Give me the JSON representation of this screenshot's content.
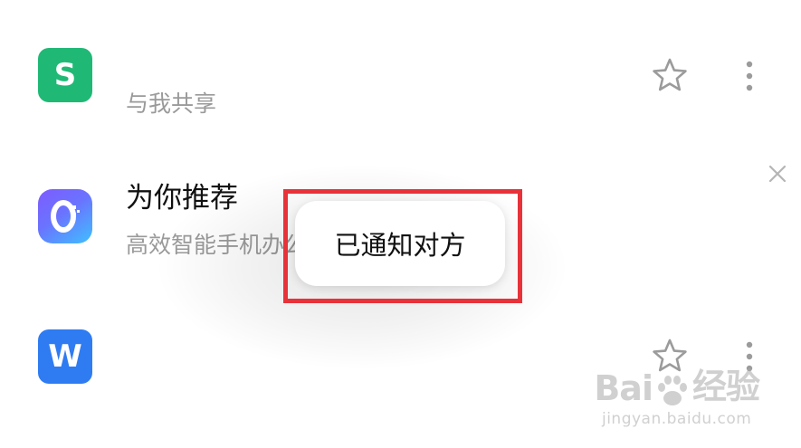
{
  "rows": [
    {
      "icon_letter": "S",
      "icon_color": "#1fb975",
      "subtitle": "与我共享"
    },
    {
      "icon_letter": "O",
      "title": "为你推荐",
      "subtitle": "高效智能手机办公，抢"
    },
    {
      "icon_letter": "W",
      "icon_color": "#2f7cf2"
    }
  ],
  "toast": {
    "message": "已通知对方"
  },
  "highlight_color": "#e8323a",
  "icons": [
    "star-icon",
    "more-vertical-icon",
    "close-icon"
  ],
  "watermark": {
    "brand_left": "Bai",
    "brand_right": "经验",
    "url": "jingyan.baidu.com"
  }
}
